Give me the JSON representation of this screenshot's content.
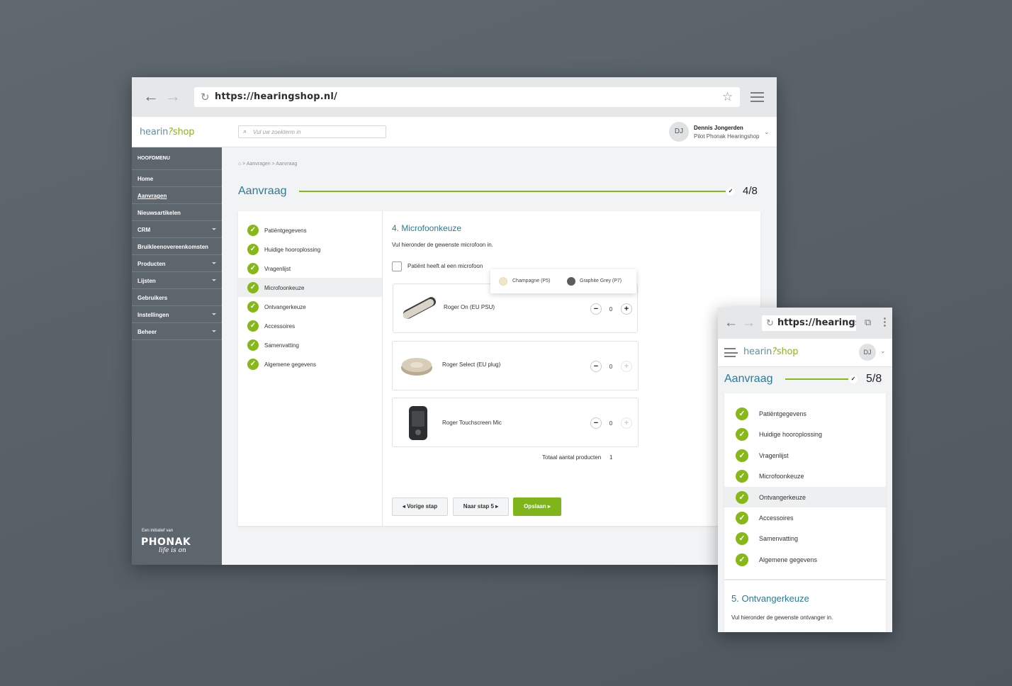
{
  "desktop": {
    "browser": {
      "back": "←",
      "forward": "→",
      "url": "https://hearingshop.nl/"
    },
    "header": {
      "logo_a": "hearin",
      "logo_b": "shop",
      "logo_mark": "?",
      "search_placeholder": "Vul uw zoekterm in",
      "avatar": "DJ",
      "user_name": "Dennis Jongerden",
      "user_role": "Pilot Phonak Hearingshop"
    },
    "sidebar": {
      "heading": "HOOFDMENU",
      "items": [
        {
          "label": "Home"
        },
        {
          "label": "Aanvragen"
        },
        {
          "label": "Nieuwsartikelen"
        },
        {
          "label": "CRM"
        },
        {
          "label": "Bruikleenovereenkomsten"
        },
        {
          "label": "Producten"
        },
        {
          "label": "Lijsten"
        },
        {
          "label": "Gebruikers"
        },
        {
          "label": "Instellingen"
        },
        {
          "label": "Beheer"
        }
      ],
      "initiative": "Een initiatief van",
      "brand": "PHONAK",
      "tagline": "life is on"
    },
    "breadcrumb": {
      "b1": "Aanvragen",
      "b2": "Aanvraag"
    },
    "title": "Aanvraag",
    "progress": {
      "label": "4/8",
      "fraction": 1.0
    },
    "steps": [
      "Patiëntgegevens",
      "Huidige hooroplossing",
      "Vragenlijst",
      "Microfoonkeuze",
      "Ontvangerkeuze",
      "Accessoires",
      "Samenvatting",
      "Algemene gegevens"
    ],
    "section": {
      "title": "4. Microfoonkeuze",
      "subtitle": "Vul hieronder de gewenste microfoon in.",
      "checkbox_label": "Patiënt heeft al een microfoon"
    },
    "colors": [
      {
        "label": "Champagne (P5)",
        "hex": "#f1e7c8"
      },
      {
        "label": "Graphite Grey (P7)",
        "hex": "#5b5d60"
      }
    ],
    "products": [
      {
        "name": "Roger On (EU PSU)",
        "qty": "0",
        "minus": "−",
        "plus": "+"
      },
      {
        "name": "Roger Select (EU plug)",
        "qty": "0",
        "minus": "−",
        "plus": "+"
      },
      {
        "name": "Roger Touchscreen Mic",
        "qty": "0",
        "minus": "−",
        "plus": "+"
      }
    ],
    "total": {
      "label": "Totaal aantal producten",
      "value": "1"
    },
    "buttons": {
      "prev": "Vorige stap",
      "next": "Naar stap 5",
      "save": "Opslaan"
    }
  },
  "mobile": {
    "browser": {
      "back": "←",
      "forward": "→",
      "url": "https://hearingshop.nl/"
    },
    "header": {
      "logo_a": "hearin",
      "logo_b": "shop",
      "logo_mark": "?",
      "avatar": "DJ"
    },
    "title": "Aanvraag",
    "progress": {
      "label": "5/8",
      "fraction": 1.0
    },
    "steps": [
      "Patiëntgegevens",
      "Huidige hooroplossing",
      "Vragenlijst",
      "Microfoonkeuze",
      "Ontvangerkeuze",
      "Accessoires",
      "Samenvatting",
      "Algemene gegevens"
    ],
    "section": {
      "title": "5. Ontvangerkeuze",
      "subtitle": "Vul hieronder de gewenste ontvanger in."
    }
  },
  "theme": {
    "accent": "#86b817",
    "primary": "#2d7a96",
    "sidebar": "#5d656d"
  }
}
